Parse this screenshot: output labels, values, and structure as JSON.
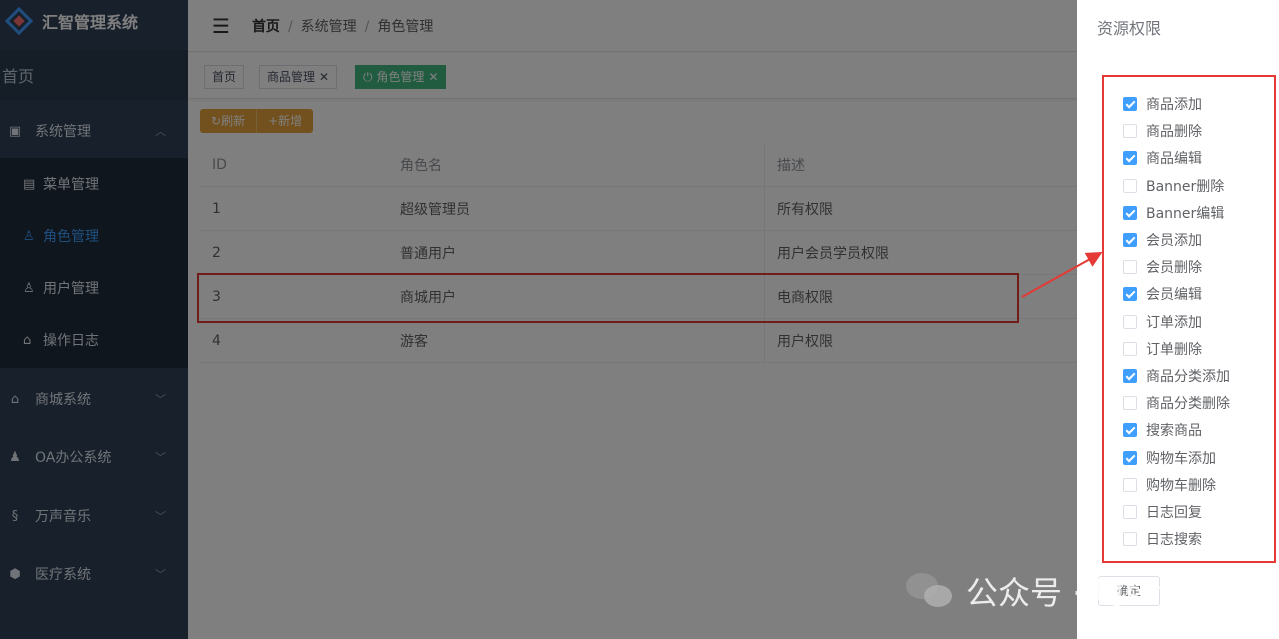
{
  "app": {
    "title": "汇智管理系统"
  },
  "sidebar": {
    "home": "首页",
    "menus": [
      {
        "label": "系统管理",
        "icon": "monitor-icon",
        "glyph": "▣",
        "expanded": true
      },
      {
        "label": "商城系统",
        "icon": "home-icon",
        "glyph": "⌂",
        "expanded": false
      },
      {
        "label": "OA办公系统",
        "icon": "users-icon",
        "glyph": "♟",
        "expanded": false
      },
      {
        "label": "万声音乐",
        "icon": "music-icon",
        "glyph": "§",
        "expanded": false
      },
      {
        "label": "医疗系统",
        "icon": "shield-icon",
        "glyph": "⬢",
        "expanded": false
      }
    ],
    "submenu": [
      {
        "label": "菜单管理",
        "icon": "list-icon",
        "glyph": "▤",
        "active": false
      },
      {
        "label": "角色管理",
        "icon": "user-icon",
        "glyph": "♙",
        "active": true
      },
      {
        "label": "用户管理",
        "icon": "user-icon",
        "glyph": "♙",
        "active": false
      },
      {
        "label": "操作日志",
        "icon": "home-icon",
        "glyph": "⌂",
        "active": false
      }
    ]
  },
  "header": {
    "breadcrumb": [
      "首页",
      "系统管理",
      "角色管理"
    ]
  },
  "tags": [
    {
      "label": "首页",
      "closable": false,
      "active": false
    },
    {
      "label": "商品管理",
      "closable": true,
      "active": false
    },
    {
      "label": "角色管理",
      "closable": true,
      "active": true
    }
  ],
  "toolbar": {
    "refresh_label": "刷新",
    "add_label": "新增"
  },
  "table": {
    "headers": [
      "ID",
      "角色名",
      "描述"
    ],
    "rows": [
      [
        "1",
        "超级管理员",
        "所有权限"
      ],
      [
        "2",
        "普通用户",
        "用户会员学员权限"
      ],
      [
        "3",
        "商城用户",
        "电商权限"
      ],
      [
        "4",
        "游客",
        "用户权限"
      ]
    ],
    "highlighted_row": 3
  },
  "drawer": {
    "title": "资源权限",
    "permissions": [
      {
        "label": "商品添加",
        "checked": true
      },
      {
        "label": "商品删除",
        "checked": false
      },
      {
        "label": "商品编辑",
        "checked": true
      },
      {
        "label": "Banner删除",
        "checked": false
      },
      {
        "label": "Banner编辑",
        "checked": true
      },
      {
        "label": "会员添加",
        "checked": true
      },
      {
        "label": "会员删除",
        "checked": false
      },
      {
        "label": "会员编辑",
        "checked": true
      },
      {
        "label": "订单添加",
        "checked": false
      },
      {
        "label": "订单删除",
        "checked": false
      },
      {
        "label": "商品分类添加",
        "checked": true
      },
      {
        "label": "商品分类删除",
        "checked": false
      },
      {
        "label": "搜索商品",
        "checked": true
      },
      {
        "label": "购物车添加",
        "checked": true
      },
      {
        "label": "购物车删除",
        "checked": false
      },
      {
        "label": "日志回复",
        "checked": false
      },
      {
        "label": "日志搜索",
        "checked": false
      }
    ],
    "confirm_label": "确定"
  },
  "watermark": {
    "text": "公众号 · 周sir专栏"
  },
  "colors": {
    "sidebar_bg": "#304156",
    "accent": "#409EFF",
    "tag_active": "#42b983",
    "button_warning": "#e6a23c",
    "highlight_border": "#e53935"
  }
}
